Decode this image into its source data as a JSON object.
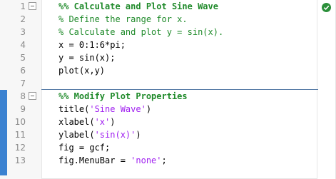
{
  "editor": {
    "lines": [
      {
        "number": "1",
        "text": "%% Calculate and Plot Sine Wave"
      },
      {
        "number": "2",
        "text": "% Define the range for x."
      },
      {
        "number": "3",
        "text": "% Calculate and plot y = sin(x)."
      },
      {
        "number": "4",
        "text": "x = 0:1:6*pi;"
      },
      {
        "number": "5",
        "text": "y = sin(x);"
      },
      {
        "number": "6",
        "text": "plot(x,y)"
      },
      {
        "number": "7",
        "text": ""
      },
      {
        "number": "8",
        "text": "%% Modify Plot Properties"
      },
      {
        "number": "9",
        "code": "title(",
        "str": "'Sine Wave'",
        "tail": ")"
      },
      {
        "number": "10",
        "code": "xlabel(",
        "str": "'x'",
        "tail": ")"
      },
      {
        "number": "11",
        "code": "ylabel(",
        "str": "'sin(x)'",
        "tail": ")"
      },
      {
        "number": "12",
        "text": "fig = gcf;"
      },
      {
        "number": "13",
        "code": "fig.MenuBar = ",
        "str": "'none'",
        "tail": ";"
      }
    ]
  },
  "status": {
    "icon": "check-circle-icon",
    "color": "#2b8f3a"
  },
  "colors": {
    "comment": "#1f8a2a",
    "string": "#a020f0",
    "active_cell": "#3b82d1"
  }
}
